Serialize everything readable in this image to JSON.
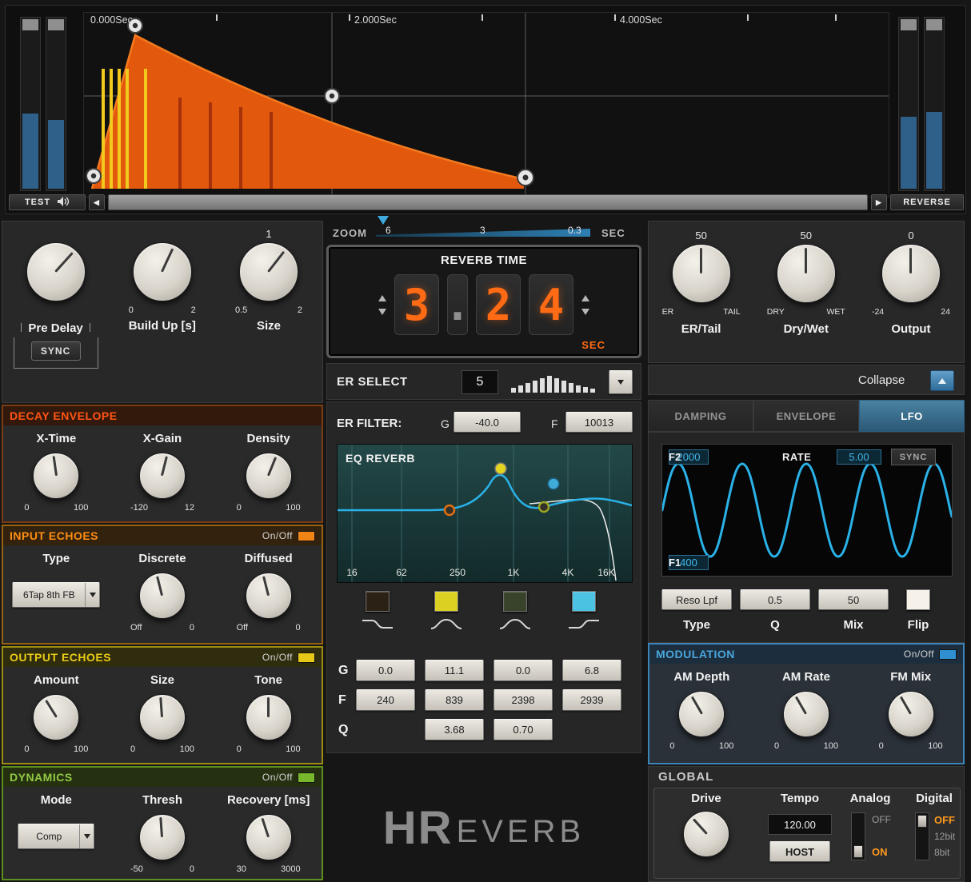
{
  "colors": {
    "accent_orange": "#ff6a14",
    "envelope_fill": "#e2580d",
    "er_bars_yellow": "#f2ca1e",
    "eq_curve_cyan": "#2ab2e8",
    "lfo_wave_cyan": "#2ab2e8",
    "modulation_accent": "#4aa6dc"
  },
  "envelope": {
    "time_labels": [
      "0.000Sec",
      "2.000Sec",
      "4.000Sec"
    ],
    "test_label": "TEST",
    "reverse_label": "REVERSE"
  },
  "zoom": {
    "label": "ZOOM",
    "t1": "6",
    "t2": "3",
    "t3": "0.3",
    "unit": "SEC"
  },
  "reverb_time": {
    "title": "REVERB TIME",
    "d1": "3",
    "d2": ".",
    "d3": "2",
    "d4": "4",
    "unit": "SEC"
  },
  "er_select": {
    "label": "ER SELECT",
    "value": "5"
  },
  "er_filter": {
    "label": "ER FILTER:",
    "g_label": "G",
    "g_value": "-40.0",
    "f_label": "F",
    "f_value": "10013"
  },
  "eq": {
    "title": "EQ REVERB",
    "freq_labels": [
      "16",
      "62",
      "250",
      "1K",
      "4K",
      "16K"
    ],
    "row_g": "G",
    "row_f": "F",
    "row_q": "Q",
    "g_values": [
      "0.0",
      "11.1",
      "0.0",
      "6.8"
    ],
    "f_values": [
      "240",
      "839",
      "2398",
      "2939"
    ],
    "q_values": [
      "3.68",
      "0.70"
    ]
  },
  "logo": {
    "hr": "HR",
    "rest": "EVERB"
  },
  "left": {
    "pre_delay": {
      "label": "Pre Delay",
      "sync": "SYNC"
    },
    "build_up": {
      "label": "Build Up [s]",
      "min": "0",
      "max": "2"
    },
    "size": {
      "label": "Size",
      "top": "1",
      "min": "0.5",
      "max": "2"
    },
    "decay": {
      "title": "DECAY ENVELOPE",
      "k1": {
        "label": "X-Time",
        "min": "0",
        "max": "100"
      },
      "k2": {
        "label": "X-Gain",
        "min": "-120",
        "max": "12"
      },
      "k3": {
        "label": "Density",
        "min": "0",
        "max": "100"
      }
    },
    "input_echoes": {
      "title": "INPUT ECHOES",
      "onoff": "On/Off",
      "type_label": "Type",
      "type_value": "6Tap 8th FB",
      "k1": {
        "label": "Discrete",
        "min": "Off",
        "max": "0"
      },
      "k2": {
        "label": "Diffused",
        "min": "Off",
        "max": "0"
      }
    },
    "output_echoes": {
      "title": "OUTPUT ECHOES",
      "onoff": "On/Off",
      "k1": {
        "label": "Amount",
        "min": "0",
        "max": "100"
      },
      "k2": {
        "label": "Size",
        "min": "0",
        "max": "100"
      },
      "k3": {
        "label": "Tone",
        "min": "0",
        "max": "100"
      }
    },
    "dynamics": {
      "title": "DYNAMICS",
      "onoff": "On/Off",
      "mode_label": "Mode",
      "mode_value": "Comp",
      "k1": {
        "label": "Thresh",
        "min": "-50",
        "max": "0"
      },
      "k2": {
        "label": "Recovery [ms]",
        "min": "30",
        "max": "3000"
      }
    }
  },
  "right": {
    "er_tail": {
      "value": "50",
      "min": "ER",
      "max": "TAIL",
      "label": "ER/Tail"
    },
    "dry_wet": {
      "value": "50",
      "min": "DRY",
      "max": "WET",
      "label": "Dry/Wet"
    },
    "output": {
      "value": "0",
      "min": "-24",
      "max": "24",
      "label": "Output"
    },
    "collapse_label": "Collapse",
    "tabs": {
      "t1": "DAMPING",
      "t2": "ENVELOPE",
      "t3": "LFO"
    },
    "lfo": {
      "f2_label": "F2",
      "f2_value": "2000",
      "rate_label": "RATE",
      "rate_value": "5.00",
      "sync": "SYNC",
      "f1_label": "F1",
      "f1_value": "400",
      "type_value": "Reso Lpf",
      "q_value": "0.5",
      "mix_value": "50",
      "type_label": "Type",
      "q_label": "Q",
      "mix_label": "Mix",
      "flip_label": "Flip"
    },
    "modulation": {
      "title": "MODULATION",
      "onoff": "On/Off",
      "k1": {
        "label": "AM Depth",
        "min": "0",
        "max": "100"
      },
      "k2": {
        "label": "AM Rate",
        "min": "0",
        "max": "100"
      },
      "k3": {
        "label": "FM Mix",
        "min": "0",
        "max": "100"
      }
    },
    "global": {
      "title": "GLOBAL",
      "drive_label": "Drive",
      "tempo_label": "Tempo",
      "tempo_value": "120.00",
      "host_label": "HOST",
      "analog_label": "Analog",
      "analog_off": "OFF",
      "analog_on": "ON",
      "digital_label": "Digital",
      "digital_off": "OFF",
      "digital_12bit": "12bit",
      "digital_8bit": "8bit"
    }
  }
}
